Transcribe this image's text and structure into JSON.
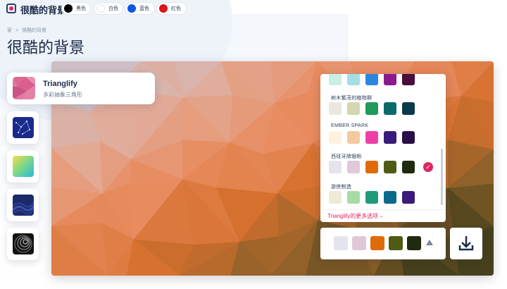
{
  "header": {
    "brand": "很酷的背景",
    "colors": [
      {
        "label": "黑色",
        "color": "#000000"
      },
      {
        "label": "白色",
        "color": "#ffffff"
      },
      {
        "label": "蓝色",
        "color": "#0a56e6"
      },
      {
        "label": "红色",
        "color": "#e01414"
      }
    ]
  },
  "breadcrumb": [
    "家",
    ">",
    "很酷的背景"
  ],
  "page_title": "很酷的背景",
  "generator": {
    "name": "Trianglify",
    "description": "多彩抽象三角形"
  },
  "generators": [
    {
      "icon": "trianglify-thumb-icon",
      "selected": true
    },
    {
      "icon": "constellation-thumb-icon"
    },
    {
      "icon": "gradient-thumb-icon"
    },
    {
      "icon": "waves-thumb-icon"
    },
    {
      "icon": "swirl-thumb-icon"
    }
  ],
  "palettes": [
    {
      "name": "",
      "colors": [
        "#c9efe4",
        "#a4dde6",
        "#2a86e0",
        "#8b1a8e",
        "#4a0e3a"
      ]
    },
    {
      "name": "树木繁茂的植物群",
      "colors": [
        "#ece6e1",
        "#d4d6b0",
        "#1f9a5a",
        "#0a6a6a",
        "#0a3a4a"
      ]
    },
    {
      "name": "EMBER SPARK",
      "colors": [
        "#fdf2de",
        "#f4c9a0",
        "#ef3fa6",
        "#3a1a7a",
        "#2a0e4a"
      ]
    },
    {
      "name": "西班牙牌银粉",
      "colors": [
        "#e4e4ec",
        "#e0c8d8",
        "#e06a0a",
        "#4f5a14",
        "#1f2a0e"
      ],
      "selected": true
    },
    {
      "name": "游侠制造",
      "colors": [
        "#efead6",
        "#a6dca4",
        "#1f9a7a",
        "#0a6a8a",
        "#3a1a7a"
      ]
    }
  ],
  "more_options": "Trianglify的更多选项→",
  "current_palette": [
    "#e4e4ec",
    "#e0c8d8",
    "#e06a0a",
    "#4f5a14",
    "#1f2a0e"
  ],
  "icons": {
    "check": "check-icon",
    "toggle": "triangle-up-icon",
    "download": "download-icon"
  }
}
